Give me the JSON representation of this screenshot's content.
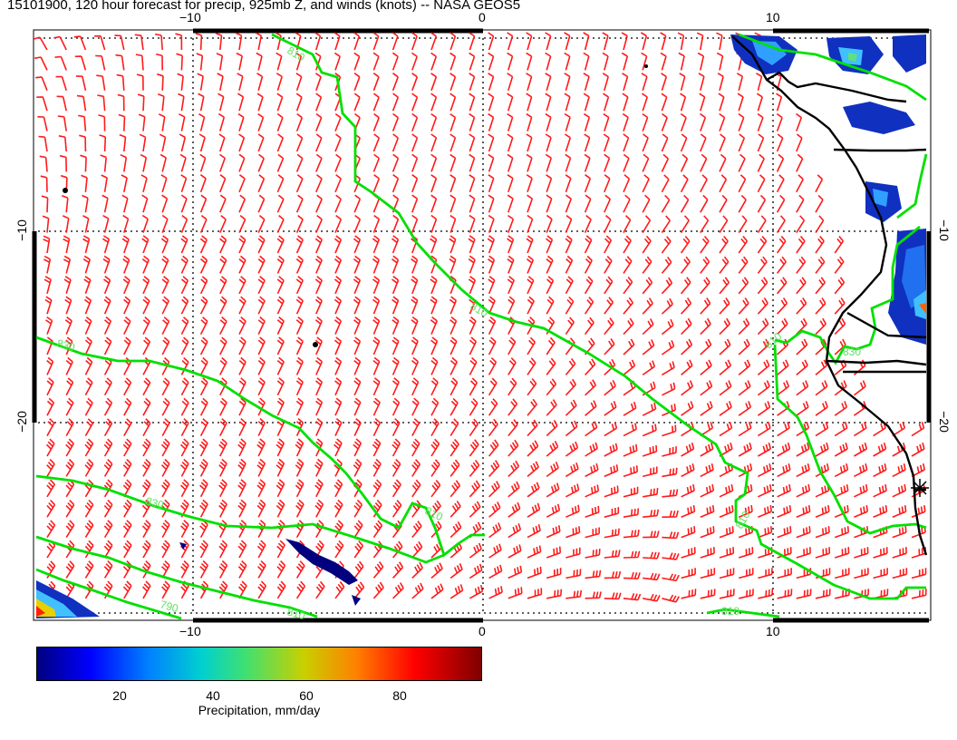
{
  "title": "15101900, 120 hour forecast for precip, 925mb Z, and winds (knots) -- NASA GEOS5",
  "map": {
    "lon_range": [
      -15.5,
      15.5
    ],
    "lat_range": [
      -30,
      0
    ],
    "grid_lon": [
      -10,
      0,
      10
    ],
    "grid_lat": [
      -10,
      -20
    ],
    "grid_style": "dotted",
    "top_ticks": [
      "−10",
      "0",
      "10"
    ],
    "bottom_ticks": [
      "−10",
      "0",
      "10"
    ],
    "left_ticks": [
      "−10",
      "−20"
    ],
    "right_ticks": [
      "−10",
      "−20"
    ],
    "contour_labels": [
      "810",
      "810",
      "830",
      "830",
      "810",
      "810",
      "810",
      "810",
      "790",
      "830",
      "810"
    ],
    "contour_color": "#00e000",
    "wind_barb_color": "#ff0000",
    "coastline_color": "#000000"
  },
  "colorbar": {
    "label": "Precipitation, mm/day",
    "ticks": [
      "20",
      "40",
      "60",
      "80"
    ],
    "tick_values": [
      20,
      40,
      60,
      80
    ],
    "range": [
      2,
      97
    ]
  }
}
